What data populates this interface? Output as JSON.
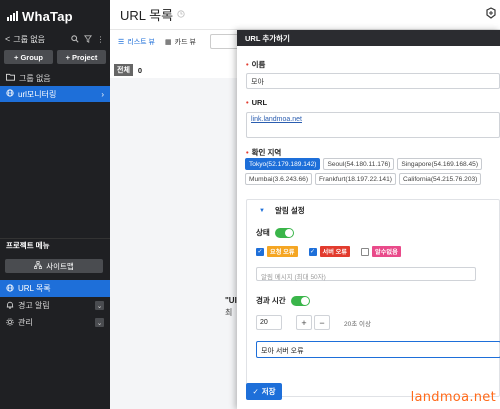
{
  "app": {
    "logo_text": "WhaTap"
  },
  "sidebar": {
    "group_back": "<",
    "group_name": "그룹 없음",
    "add_group_label": "Group",
    "add_project_label": "Project",
    "items": [
      {
        "label": "그룹 없음",
        "icon": "folder-icon"
      },
      {
        "label": "url모니터링",
        "icon": "globe-icon"
      }
    ],
    "menu_title": "프로젝트 메뉴",
    "siteview_label": "사이트맵",
    "bottom_items": [
      {
        "label": "URL 목록",
        "icon": "globe-icon"
      },
      {
        "label": "경고 알림",
        "icon": "bell-icon"
      },
      {
        "label": "관리",
        "icon": "gear-icon"
      }
    ]
  },
  "main": {
    "title": "URL 목록",
    "tabs": [
      {
        "label": "리스트 뷰"
      },
      {
        "label": "카드 뷰"
      }
    ],
    "filter_tag": "전체",
    "filter_count": "0",
    "empty_line1": "\"UI",
    "empty_line2": "최"
  },
  "panel": {
    "title": "URL 추가하기",
    "name_label": "이름",
    "name_value": "모아",
    "url_label": "URL",
    "url_value": "link.landmoa.net",
    "region_label": "확인 지역",
    "regions": [
      {
        "label": "Tokyo(52.179.189.142)",
        "selected": true
      },
      {
        "label": "Seoul(54.180.11.176)",
        "selected": false
      },
      {
        "label": "Singapore(54.169.168.45)",
        "selected": false
      },
      {
        "label": "Mumbai(3.6.243.66)",
        "selected": false
      },
      {
        "label": "Frankfurt(18.197.22.141)",
        "selected": false
      },
      {
        "label": "California(54.215.76.203)",
        "selected": false
      }
    ],
    "alert_section": {
      "title": "알림 설정",
      "status_label": "상태",
      "status_on": true,
      "checks": [
        {
          "label": "요청 오류",
          "checked": true,
          "color": "#f5a623"
        },
        {
          "label": "서버 오류",
          "checked": true,
          "color": "#e23b2e"
        },
        {
          "label": "알수없음",
          "checked": false,
          "color": "#e94a8a"
        }
      ],
      "message_placeholder": "알림 메시지 (최대 50자)",
      "elapsed_label": "경과 시간",
      "elapsed_on": true,
      "stepper_value": "20",
      "stepper_plus": "+",
      "stepper_minus": "−",
      "stepper_hint": "20초 이상",
      "message_value": "모아 서버 오류"
    },
    "save_label": "저장"
  },
  "watermark": "landmoa.net",
  "colors": {
    "accent": "#1e6fd9",
    "sidebar": "#1f2023",
    "toggle_on": "#3ab54a"
  }
}
